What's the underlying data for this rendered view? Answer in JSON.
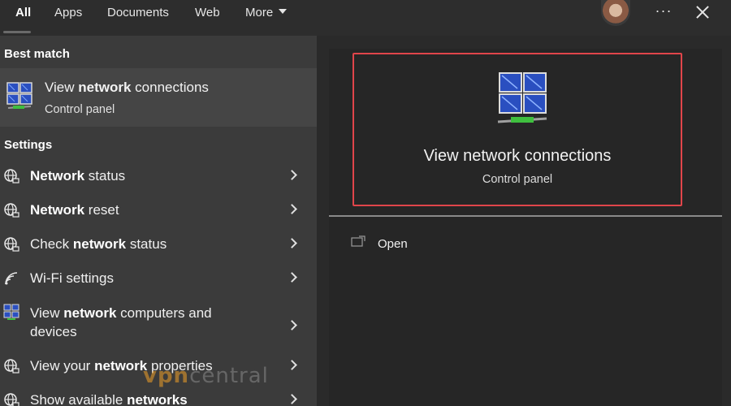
{
  "tabs": [
    {
      "label": "All",
      "active": true
    },
    {
      "label": "Apps",
      "active": false
    },
    {
      "label": "Documents",
      "active": false
    },
    {
      "label": "Web",
      "active": false
    },
    {
      "label": "More",
      "active": false
    }
  ],
  "header_icons": {
    "avatar": "user-avatar",
    "more_options": "ellipsis-icon",
    "close": "close-icon"
  },
  "best_match": {
    "heading": "Best match",
    "title_pre": "View ",
    "title_bold": "network",
    "title_post": " connections",
    "subtitle": "Control panel",
    "icon": "network-connections-icon"
  },
  "settings": {
    "heading": "Settings",
    "items": [
      {
        "pre": "",
        "bold": "Network",
        "post": " status",
        "icon": "globe-icon"
      },
      {
        "pre": "",
        "bold": "Network",
        "post": " reset",
        "icon": "globe-icon"
      },
      {
        "pre": "Check ",
        "bold": "network",
        "post": " status",
        "icon": "globe-icon"
      },
      {
        "pre": "Wi-Fi settings",
        "bold": "",
        "post": "",
        "icon": "wifi-icon"
      },
      {
        "pre": "View ",
        "bold": "network",
        "post": " computers and devices",
        "icon": "network-computers-icon"
      },
      {
        "pre": "View your ",
        "bold": "network",
        "post": " properties",
        "icon": "globe-icon"
      },
      {
        "pre": "Show available ",
        "bold": "networks",
        "post": "",
        "icon": "globe-icon"
      }
    ]
  },
  "preview": {
    "title": "View network connections",
    "subtitle": "Control panel",
    "icon": "network-connections-icon",
    "highlight_color": "#e0454a"
  },
  "actions": [
    {
      "label": "Open",
      "icon": "open-window-icon"
    }
  ],
  "watermark": {
    "brand_a": "vpn",
    "brand_b": "central"
  }
}
